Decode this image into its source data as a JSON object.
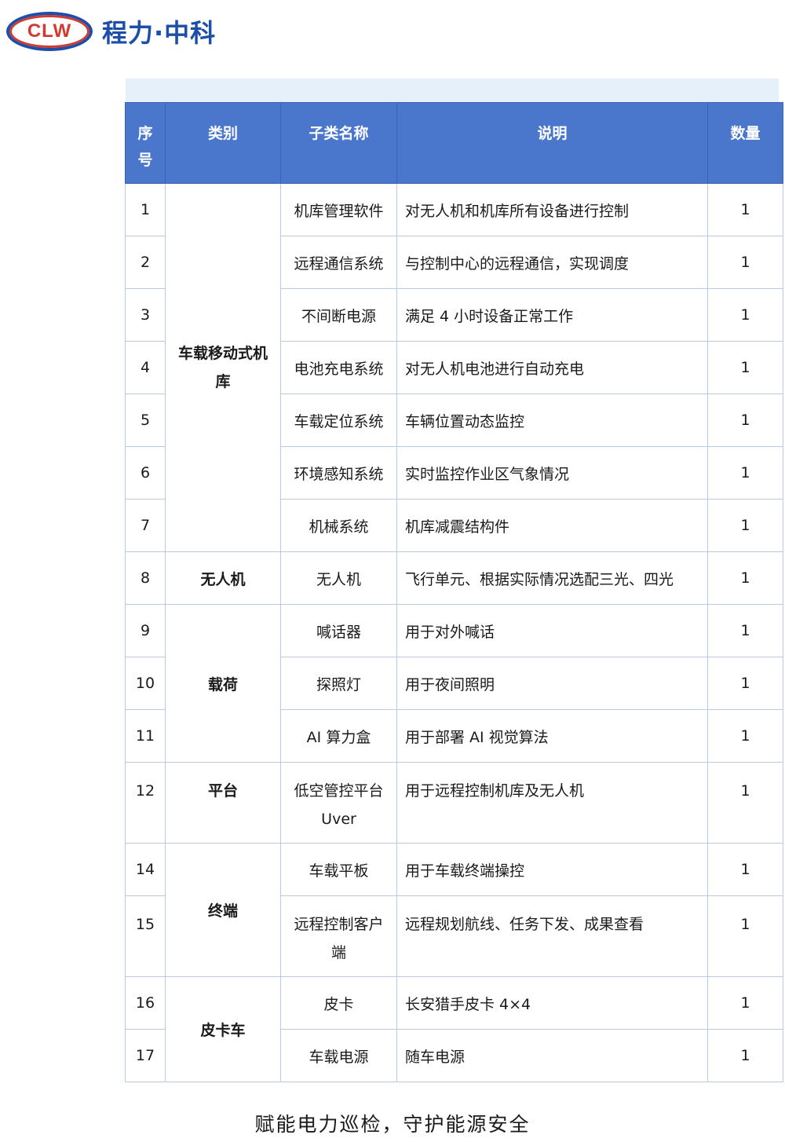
{
  "logo": {
    "abbr": "CLW",
    "name": "程力·中科"
  },
  "table": {
    "headers": {
      "index": "序号",
      "category": "类别",
      "subcategory": "子类名称",
      "description": "说明",
      "quantity": "数量"
    },
    "rows": [
      {
        "index": "1",
        "category": "车载移动式机库",
        "sub": "机库管理软件",
        "desc": "对无人机和机库所有设备进行控制",
        "qty": "1"
      },
      {
        "index": "2",
        "sub": "远程通信系统",
        "desc": "与控制中心的远程通信，实现调度",
        "qty": "1"
      },
      {
        "index": "3",
        "sub": "不间断电源",
        "desc": "满足 4 小时设备正常工作",
        "qty": "1"
      },
      {
        "index": "4",
        "sub": "电池充电系统",
        "desc": "对无人机电池进行自动充电",
        "qty": "1"
      },
      {
        "index": "5",
        "sub": "车载定位系统",
        "desc": "车辆位置动态监控",
        "qty": "1"
      },
      {
        "index": "6",
        "sub": "环境感知系统",
        "desc": "实时监控作业区气象情况",
        "qty": "1"
      },
      {
        "index": "7",
        "sub": "机械系统",
        "desc": "机库减震结构件",
        "qty": "1"
      },
      {
        "index": "8",
        "category": "无人机",
        "sub": "无人机",
        "desc": "飞行单元、根据实际情况选配三光、四光",
        "qty": "1"
      },
      {
        "index": "9",
        "category": "载荷",
        "sub": "喊话器",
        "desc": "用于对外喊话",
        "qty": "1"
      },
      {
        "index": "10",
        "sub": "探照灯",
        "desc": "用于夜间照明",
        "qty": "1"
      },
      {
        "index": "11",
        "sub": "AI 算力盒",
        "desc": "用于部署 AI 视觉算法",
        "qty": "1"
      },
      {
        "index": "12",
        "category": "平台",
        "sub": "低空管控平台 Uver",
        "desc": "用于远程控制机库及无人机",
        "qty": "1"
      },
      {
        "index": "14",
        "category": "终端",
        "sub": "车载平板",
        "desc": "用于车载终端操控",
        "qty": "1"
      },
      {
        "index": "15",
        "sub": "远程控制客户端",
        "desc": "远程规划航线、任务下发、成果查看",
        "qty": "1"
      },
      {
        "index": "16",
        "category": "皮卡车",
        "sub": "皮卡",
        "desc": "长安猎手皮卡 4×4",
        "qty": "1"
      },
      {
        "index": "17",
        "sub": "车载电源",
        "desc": "随车电源",
        "qty": "1"
      }
    ]
  },
  "footer": {
    "slogan": "赋能电力巡检，守护能源安全"
  },
  "colors": {
    "header_bg": "#4a77cc",
    "brand_blue": "#1d4ea8",
    "brand_red": "#d33a2f",
    "band": "#e6f0fa"
  }
}
